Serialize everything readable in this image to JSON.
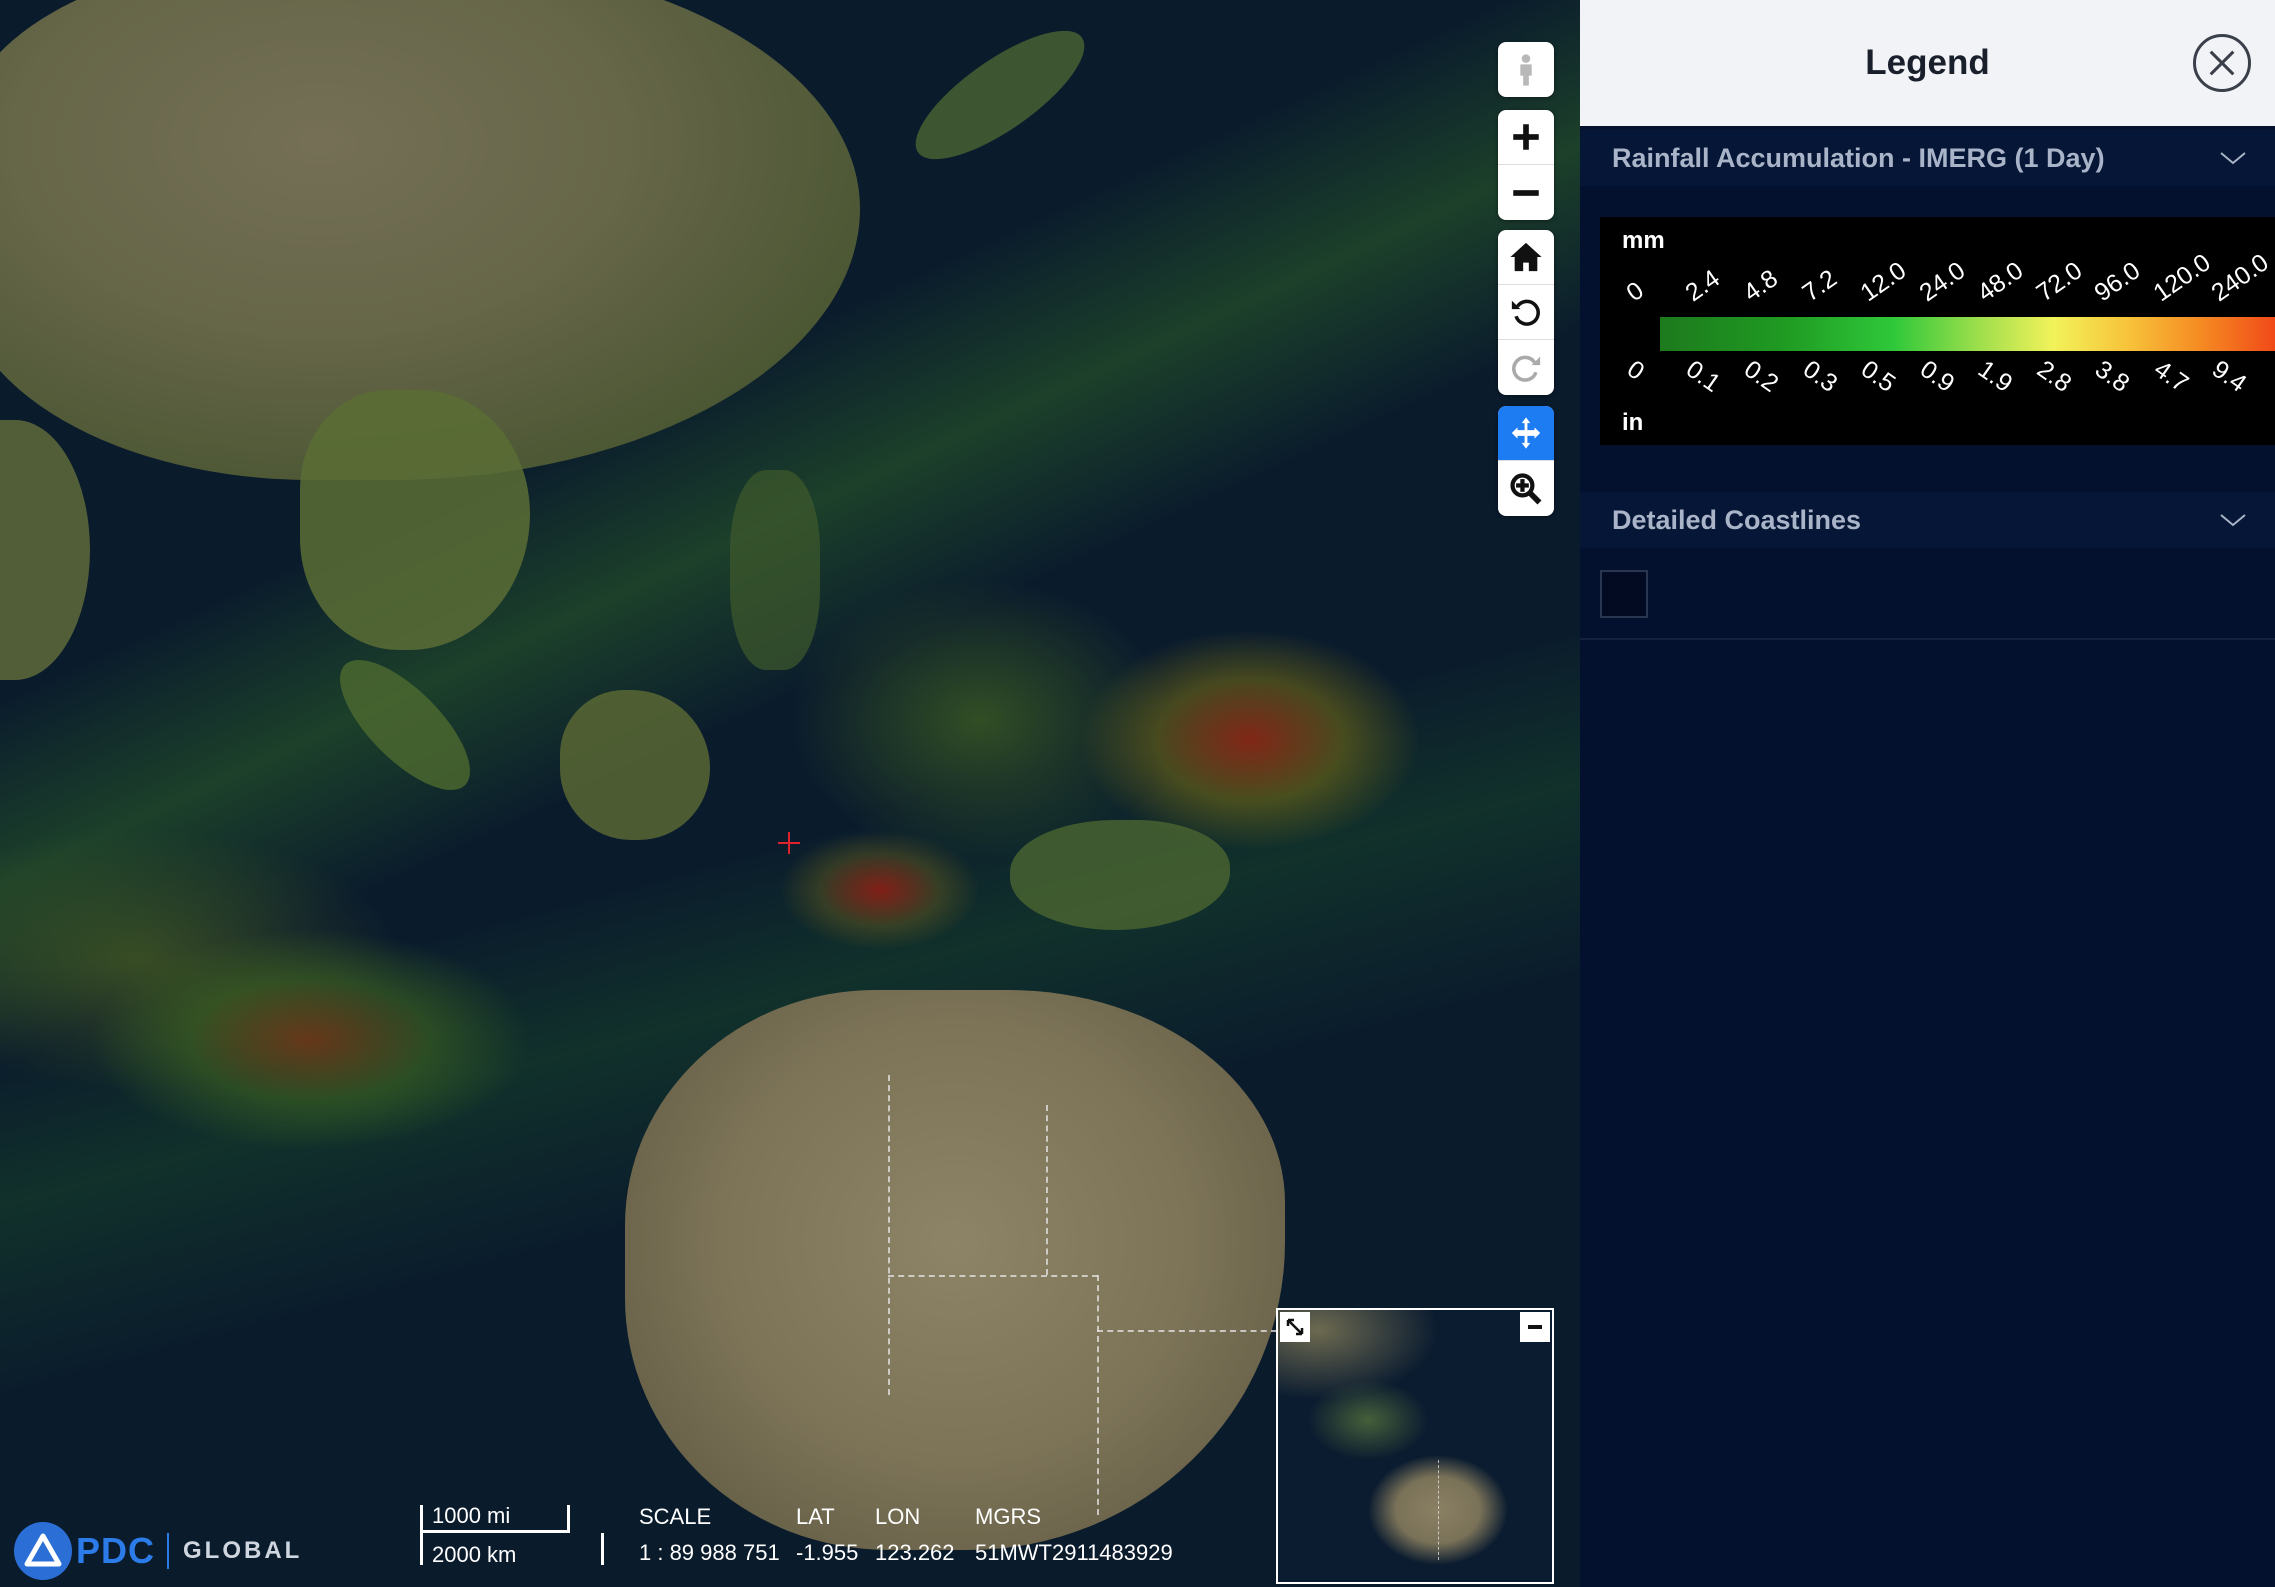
{
  "map": {
    "controls": {
      "street_view": "pegman-icon",
      "zoom_in": "plus-icon",
      "zoom_out": "minus-icon",
      "home": "home-icon",
      "rotate_left": "rotate-ccw-icon",
      "rotate_right": "rotate-cw-icon",
      "pan": "pan-icon",
      "zoom_box": "zoom-box-icon"
    },
    "scalebar": {
      "top_label": "1000 mi",
      "bottom_label": "2000 km"
    },
    "readout": {
      "scale_header": "SCALE",
      "scale_value": "1 : 89 988 751",
      "lat_header": "LAT",
      "lat_value": "-1.955",
      "lon_header": "LON",
      "lon_value": "123.262",
      "mgrs_header": "MGRS",
      "mgrs_value": "51MWT2911483929"
    },
    "logo": {
      "brand": "PDC",
      "subtitle": "GLOBAL"
    }
  },
  "legend": {
    "title": "Legend",
    "layers": [
      {
        "name": "Rainfall Accumulation - IMERG (1 Day)",
        "unit_top": "mm",
        "unit_bottom": "in",
        "mm_ticks": [
          "0",
          "2.4",
          "4.8",
          "7.2",
          "12.0",
          "24.0",
          "48.0",
          "72.0",
          "96.0",
          "120.0",
          "240.0"
        ],
        "in_ticks": [
          "0",
          "0.1",
          "0.2",
          "0.3",
          "0.5",
          "0.9",
          "1.9",
          "2.8",
          "3.8",
          "4.7",
          "9.4"
        ]
      },
      {
        "name": "Detailed Coastlines"
      }
    ],
    "colors": {
      "bar_start": "#1d7a1d",
      "bar_mid": "#f2f25a",
      "bar_end": "#f04a18"
    }
  }
}
